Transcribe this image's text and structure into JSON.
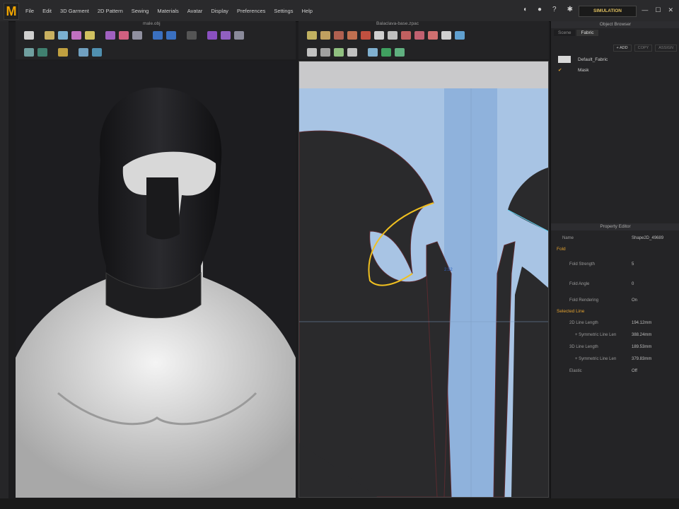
{
  "app": {
    "logo": "M"
  },
  "menu": [
    "File",
    "Edit",
    "3D Garment",
    "2D Pattern",
    "Sewing",
    "Materials",
    "Avatar",
    "Display",
    "Preferences",
    "Settings",
    "Help"
  ],
  "simulation_label": "SIMULATION",
  "window_controls": [
    "—",
    "☐",
    "✕"
  ],
  "viewport3d": {
    "file": "male.obj"
  },
  "viewport2d": {
    "file": "Balaclava-base.zpac",
    "measure": "2.52"
  },
  "object_browser": {
    "title": "Object Browser",
    "tabs": [
      "Scene",
      "Fabric"
    ],
    "buttons": [
      "+ ADD",
      "COPY",
      "ASSIGN"
    ],
    "fabrics": [
      "Default_Fabric",
      "Mask"
    ]
  },
  "property_editor": {
    "title": "Property Editor",
    "name_label": "Name",
    "name_value": "Shape2D_49689",
    "fold_section": "Fold",
    "fold_strength_label": "Fold Strength",
    "fold_strength": "5",
    "fold_angle_label": "Fold Angle",
    "fold_angle": "0",
    "fold_rendering_label": "Fold Rendering",
    "fold_rendering": "On",
    "selected_line": "Selected Line",
    "line2d_label": "2D Line Length",
    "line2d": "194.12mm",
    "sym1_label": "+ Symmetric Line Len",
    "sym1": "388.24mm",
    "line3d_label": "3D Line Length",
    "line3d": "189.53mm",
    "sym2_label": "+ Symmetric Line Len",
    "sym2": "379.83mm",
    "elastic_label": "Elastic",
    "elastic": "Off"
  },
  "colors": {
    "accent": "#f0a400",
    "pattern_bg": "#a8c4e4",
    "fabric": "#2a2a2c"
  }
}
